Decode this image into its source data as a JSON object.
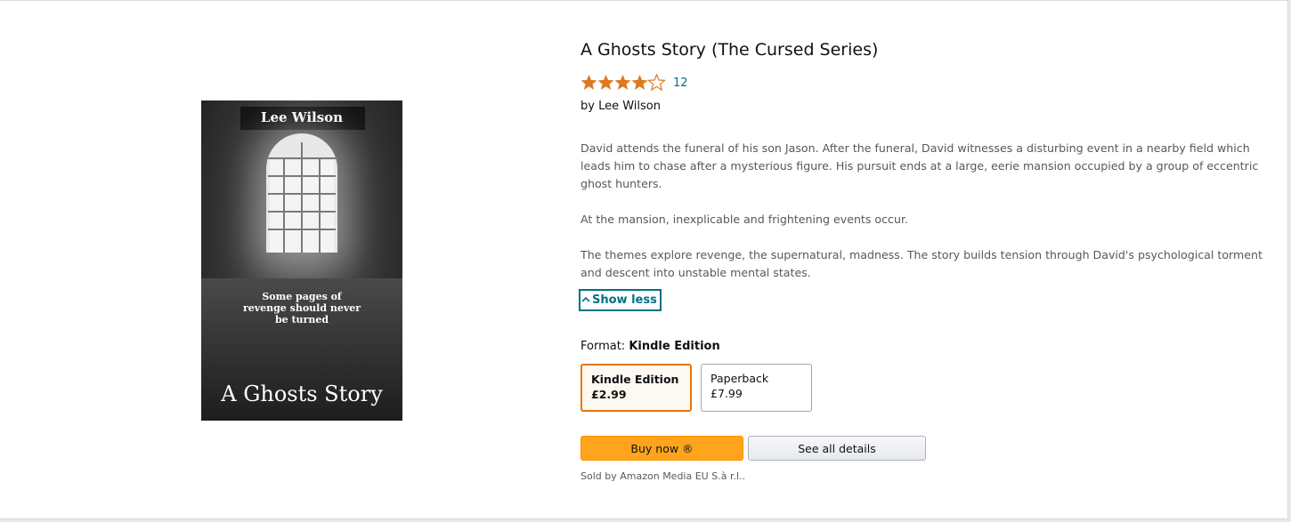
{
  "book": {
    "title": "A Ghosts Story (The Cursed Series)",
    "rating": {
      "stars": 4.5,
      "count": "12",
      "star_color": "#de7921",
      "icon": "star-icon"
    },
    "byline": {
      "prefix": "by",
      "author": "Lee Wilson"
    },
    "cover": {
      "author": "Lee Wilson",
      "tagline_lines": [
        "Some pages of",
        "revenge should never",
        "be turned"
      ],
      "title": "A Ghosts Story"
    },
    "description": [
      "David attends the funeral of his son Jason. After the funeral, David witnesses a disturbing event in a nearby field which leads him to chase after a mysterious figure. His pursuit ends at a large, eerie mansion occupied by a group of eccentric ghost hunters.",
      "At the mansion, inexplicable and frightening events occur.",
      "The themes explore revenge, the supernatural, madness. The story builds tension through David's psychological torment and descent into unstable mental states."
    ],
    "show_less_label": "Show less",
    "format": {
      "label": "Format:",
      "selected": "Kindle Edition",
      "options": [
        {
          "name": "Kindle Edition",
          "price": "£2.99"
        },
        {
          "name": "Paperback",
          "price": "£7.99"
        }
      ]
    },
    "buttons": {
      "buy_now": "Buy now ®",
      "see_all_details": "See all details"
    },
    "sold_by": "Sold by Amazon Media EU S.à r.l.."
  },
  "colors": {
    "link": "#007185",
    "buy_button": "#ffa41c",
    "selected_border": "#e77600"
  }
}
